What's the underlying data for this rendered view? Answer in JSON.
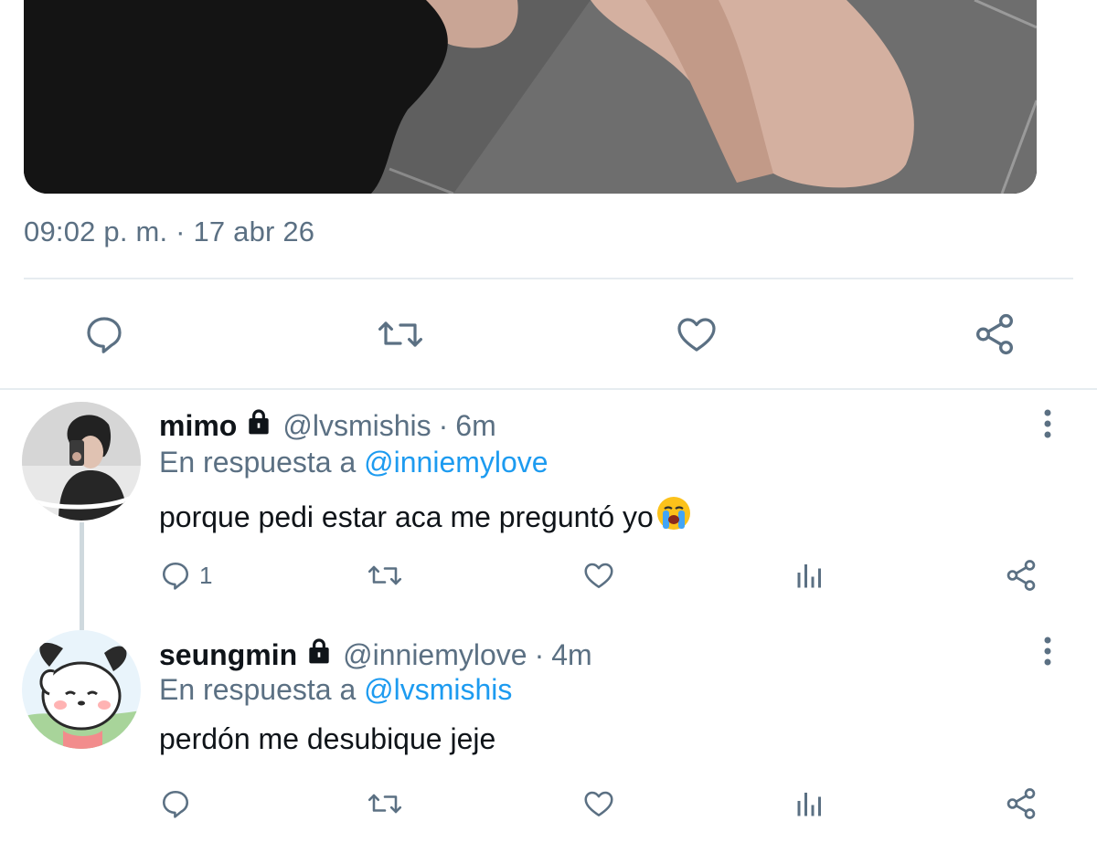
{
  "tweet": {
    "timestamp": "09:02 p. m. · 17 abr 26"
  },
  "main_actions": {
    "icons": [
      "reply-icon",
      "retweet-icon",
      "like-icon",
      "share-icon"
    ]
  },
  "replies": [
    {
      "name": "mimo",
      "handle": "@lvsmishis",
      "separator": "·",
      "time": "6m",
      "in_reply_prefix": "En respuesta a",
      "in_reply_mention": "@inniemylove",
      "text": "porque pedi estar aca me preguntó yo",
      "reply_count": "1"
    },
    {
      "name": "seungmin",
      "handle": "@inniemylove",
      "separator": "·",
      "time": "4m",
      "in_reply_prefix": "En respuesta a",
      "in_reply_mention": "@lvsmishis",
      "text": "perdón me desubique jeje",
      "reply_count": ""
    }
  ],
  "colors": {
    "accent": "#1d9bf0",
    "secondary_text": "#5b7083",
    "icon": "#5b7083",
    "divider": "#e6ecf0"
  }
}
